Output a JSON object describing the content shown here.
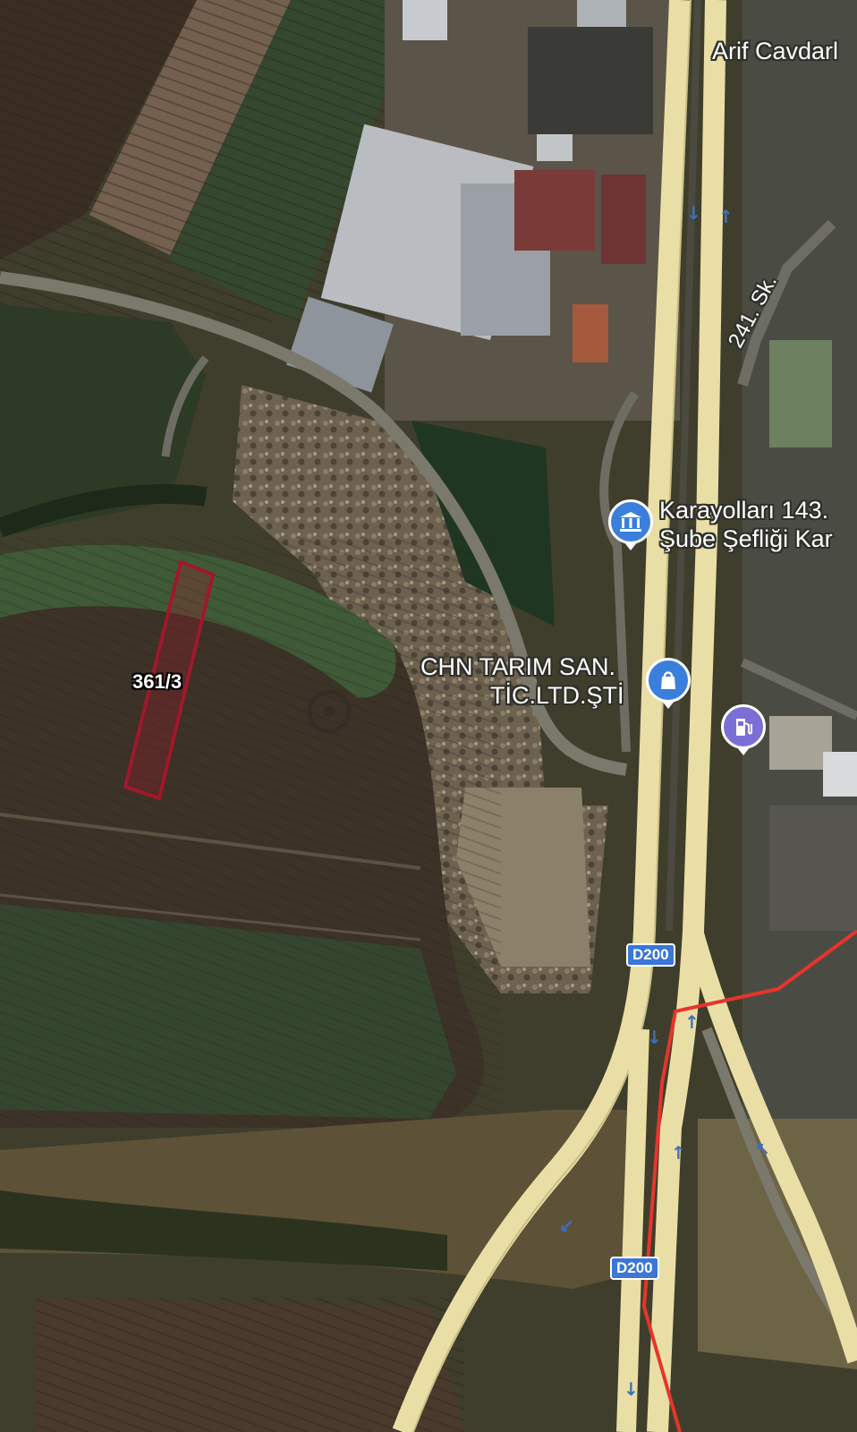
{
  "map": {
    "place_labels": {
      "arif": "Arif Cavdarl",
      "karayollari_line1": "Karayolları 143.",
      "karayollari_line2": "Şube Şefliği Kar",
      "chn_line1": "CHN TARIM SAN.",
      "chn_line2": "TİC.LTD.ŞTİ"
    },
    "street_label": "241. Sk.",
    "parcel_label": "361/3",
    "road_shields": [
      "D200",
      "D200"
    ],
    "icons": {
      "government": "landmark-icon",
      "shopping": "shopping-bag-icon",
      "fuel": "fuel-pump-icon",
      "direction_arrow": "arrow-icon"
    },
    "colors": {
      "parcel_outline": "#a0182a",
      "boundary_line": "#e8342b",
      "highway": "#e9dfa6",
      "road_shield": "#3b76d8",
      "poi_blue": "#3b7fdc",
      "poi_purple": "#7b6fd6"
    }
  }
}
